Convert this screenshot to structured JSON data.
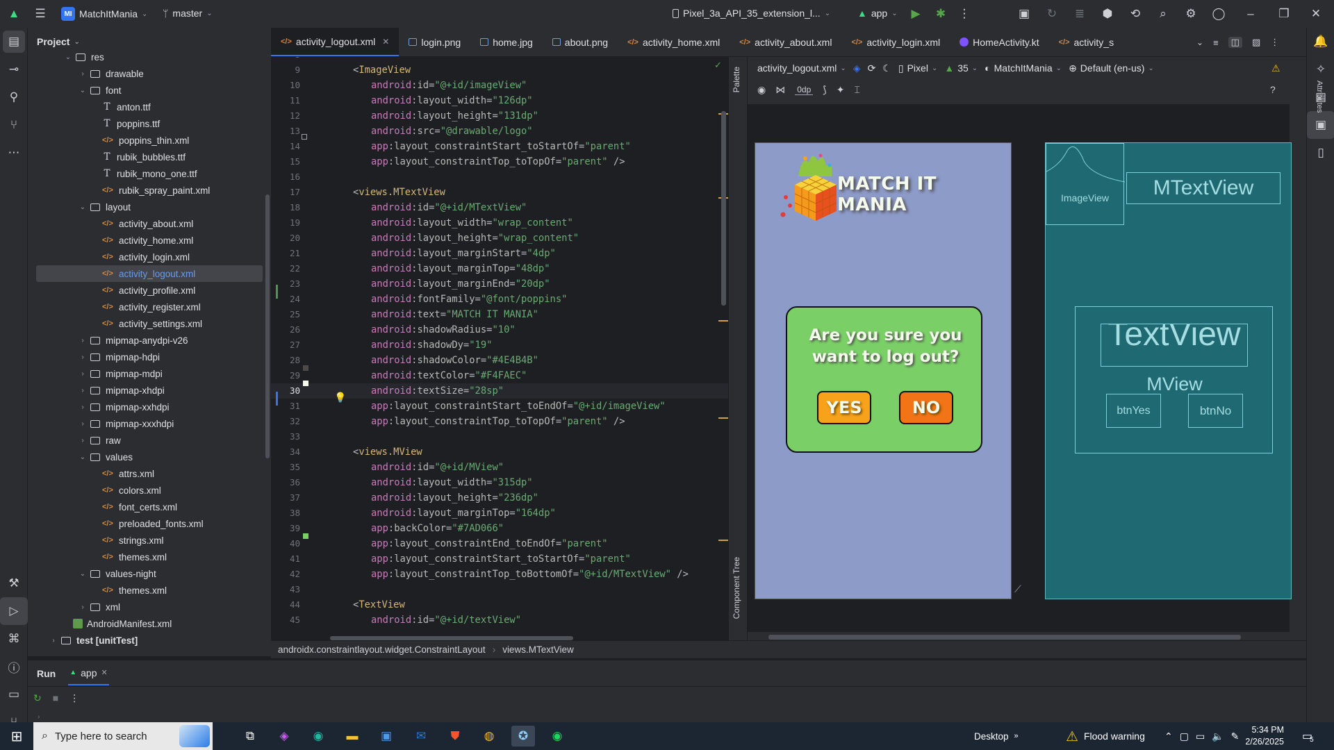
{
  "titlebar": {
    "project_badge": "MI",
    "project_name": "MatchItMania",
    "branch": "master",
    "device": "Pixel_3a_API_35_extension_l...",
    "run_config": "app"
  },
  "project_panel": {
    "title": "Project",
    "tree": [
      {
        "label": "res",
        "kind": "folder",
        "level": 3,
        "open": true
      },
      {
        "label": "drawable",
        "kind": "folder",
        "level": 4,
        "open": false
      },
      {
        "label": "font",
        "kind": "folder",
        "level": 4,
        "open": true
      },
      {
        "label": "anton.ttf",
        "kind": "font",
        "level": 5
      },
      {
        "label": "poppins.ttf",
        "kind": "font",
        "level": 5
      },
      {
        "label": "poppins_thin.xml",
        "kind": "xml",
        "level": 5
      },
      {
        "label": "rubik_bubbles.ttf",
        "kind": "font",
        "level": 5
      },
      {
        "label": "rubik_mono_one.ttf",
        "kind": "font",
        "level": 5
      },
      {
        "label": "rubik_spray_paint.xml",
        "kind": "xml",
        "level": 5
      },
      {
        "label": "layout",
        "kind": "folder",
        "level": 4,
        "open": true
      },
      {
        "label": "activity_about.xml",
        "kind": "xml",
        "level": 5
      },
      {
        "label": "activity_home.xml",
        "kind": "xml",
        "level": 5
      },
      {
        "label": "activity_login.xml",
        "kind": "xml",
        "level": 5
      },
      {
        "label": "activity_logout.xml",
        "kind": "xml",
        "level": 5,
        "selected": true
      },
      {
        "label": "activity_profile.xml",
        "kind": "xml",
        "level": 5
      },
      {
        "label": "activity_register.xml",
        "kind": "xml",
        "level": 5
      },
      {
        "label": "activity_settings.xml",
        "kind": "xml",
        "level": 5
      },
      {
        "label": "mipmap-anydpi-v26",
        "kind": "folder",
        "level": 4,
        "open": false
      },
      {
        "label": "mipmap-hdpi",
        "kind": "folder",
        "level": 4,
        "open": false
      },
      {
        "label": "mipmap-mdpi",
        "kind": "folder",
        "level": 4,
        "open": false
      },
      {
        "label": "mipmap-xhdpi",
        "kind": "folder",
        "level": 4,
        "open": false
      },
      {
        "label": "mipmap-xxhdpi",
        "kind": "folder",
        "level": 4,
        "open": false
      },
      {
        "label": "mipmap-xxxhdpi",
        "kind": "folder",
        "level": 4,
        "open": false
      },
      {
        "label": "raw",
        "kind": "folder",
        "level": 4,
        "open": false
      },
      {
        "label": "values",
        "kind": "folder",
        "level": 4,
        "open": true
      },
      {
        "label": "attrs.xml",
        "kind": "xml",
        "level": 5
      },
      {
        "label": "colors.xml",
        "kind": "xml",
        "level": 5
      },
      {
        "label": "font_certs.xml",
        "kind": "xml",
        "level": 5
      },
      {
        "label": "preloaded_fonts.xml",
        "kind": "xml",
        "level": 5
      },
      {
        "label": "strings.xml",
        "kind": "xml",
        "level": 5
      },
      {
        "label": "themes.xml",
        "kind": "xml",
        "level": 5
      },
      {
        "label": "values-night",
        "kind": "folder",
        "level": 4,
        "open": true
      },
      {
        "label": "themes.xml",
        "kind": "xml",
        "level": 5
      },
      {
        "label": "xml",
        "kind": "folder",
        "level": 4,
        "open": false
      },
      {
        "label": "AndroidManifest.xml",
        "kind": "manifest",
        "level": 3
      },
      {
        "label": "test [unitTest]",
        "kind": "folder",
        "level": 2,
        "open": false
      }
    ]
  },
  "tabs": [
    {
      "label": "activity_logout.xml",
      "kind": "xml",
      "active": true,
      "closable": true
    },
    {
      "label": "login.png",
      "kind": "png"
    },
    {
      "label": "home.jpg",
      "kind": "png"
    },
    {
      "label": "about.png",
      "kind": "png"
    },
    {
      "label": "activity_home.xml",
      "kind": "xml"
    },
    {
      "label": "activity_about.xml",
      "kind": "xml"
    },
    {
      "label": "activity_login.xml",
      "kind": "xml"
    },
    {
      "label": "HomeActivity.kt",
      "kind": "kt"
    },
    {
      "label": "activity_s",
      "kind": "xml"
    }
  ],
  "editor": {
    "current_line": 30,
    "lines": [
      {
        "n": "8",
        "parts": []
      },
      {
        "n": "9",
        "parts": [
          [
            "pun",
            "<"
          ],
          [
            "tag",
            "ImageView"
          ]
        ],
        "indent": 0
      },
      {
        "n": "10",
        "indent": 1,
        "parts": [
          [
            "ns",
            "android"
          ],
          [
            "pun",
            ":"
          ],
          [
            "attr",
            "id"
          ],
          [
            "pun",
            "="
          ],
          [
            "str",
            "\"@+id/imageView\""
          ]
        ]
      },
      {
        "n": "11",
        "indent": 1,
        "parts": [
          [
            "ns",
            "android"
          ],
          [
            "pun",
            ":"
          ],
          [
            "attr",
            "layout_width"
          ],
          [
            "pun",
            "="
          ],
          [
            "str",
            "\"126dp\""
          ]
        ]
      },
      {
        "n": "12",
        "indent": 1,
        "parts": [
          [
            "ns",
            "android"
          ],
          [
            "pun",
            ":"
          ],
          [
            "attr",
            "layout_height"
          ],
          [
            "pun",
            "="
          ],
          [
            "str",
            "\"131dp\""
          ]
        ]
      },
      {
        "n": "13",
        "indent": 1,
        "parts": [
          [
            "ns",
            "android"
          ],
          [
            "pun",
            ":"
          ],
          [
            "attr",
            "src"
          ],
          [
            "pun",
            "="
          ],
          [
            "str",
            "\"@drawable/logo\""
          ]
        ]
      },
      {
        "n": "14",
        "indent": 1,
        "parts": [
          [
            "ns",
            "app"
          ],
          [
            "pun",
            ":"
          ],
          [
            "attr",
            "layout_constraintStart_toStartOf"
          ],
          [
            "pun",
            "="
          ],
          [
            "str",
            "\"parent\""
          ]
        ]
      },
      {
        "n": "15",
        "indent": 1,
        "parts": [
          [
            "ns",
            "app"
          ],
          [
            "pun",
            ":"
          ],
          [
            "attr",
            "layout_constraintTop_toTopOf"
          ],
          [
            "pun",
            "="
          ],
          [
            "str",
            "\"parent\""
          ],
          [
            "pun",
            " />"
          ]
        ]
      },
      {
        "n": "16",
        "parts": []
      },
      {
        "n": "17",
        "indent": 0,
        "parts": [
          [
            "pun",
            "<"
          ],
          [
            "tag",
            "views.MTextView"
          ]
        ]
      },
      {
        "n": "18",
        "indent": 1,
        "parts": [
          [
            "ns",
            "android"
          ],
          [
            "pun",
            ":"
          ],
          [
            "attr",
            "id"
          ],
          [
            "pun",
            "="
          ],
          [
            "str",
            "\"@+id/MTextView\""
          ]
        ]
      },
      {
        "n": "19",
        "indent": 1,
        "parts": [
          [
            "ns",
            "android"
          ],
          [
            "pun",
            ":"
          ],
          [
            "attr",
            "layout_width"
          ],
          [
            "pun",
            "="
          ],
          [
            "str",
            "\"wrap_content\""
          ]
        ]
      },
      {
        "n": "20",
        "indent": 1,
        "parts": [
          [
            "ns",
            "android"
          ],
          [
            "pun",
            ":"
          ],
          [
            "attr",
            "layout_height"
          ],
          [
            "pun",
            "="
          ],
          [
            "str",
            "\"wrap_content\""
          ]
        ]
      },
      {
        "n": "21",
        "indent": 1,
        "parts": [
          [
            "ns",
            "android"
          ],
          [
            "pun",
            ":"
          ],
          [
            "attr",
            "layout_marginStart"
          ],
          [
            "pun",
            "="
          ],
          [
            "str",
            "\"4dp\""
          ]
        ]
      },
      {
        "n": "22",
        "indent": 1,
        "parts": [
          [
            "ns",
            "android"
          ],
          [
            "pun",
            ":"
          ],
          [
            "attr",
            "layout_marginTop"
          ],
          [
            "pun",
            "="
          ],
          [
            "str",
            "\"48dp\""
          ]
        ]
      },
      {
        "n": "23",
        "indent": 1,
        "parts": [
          [
            "ns",
            "android"
          ],
          [
            "pun",
            ":"
          ],
          [
            "attr",
            "layout_marginEnd"
          ],
          [
            "pun",
            "="
          ],
          [
            "str",
            "\"20dp\""
          ]
        ]
      },
      {
        "n": "24",
        "indent": 1,
        "parts": [
          [
            "ns",
            "android"
          ],
          [
            "pun",
            ":"
          ],
          [
            "attr",
            "fontFamily"
          ],
          [
            "pun",
            "="
          ],
          [
            "str",
            "\"@font/poppins\""
          ]
        ]
      },
      {
        "n": "25",
        "indent": 1,
        "parts": [
          [
            "ns",
            "android"
          ],
          [
            "pun",
            ":"
          ],
          [
            "attr",
            "text"
          ],
          [
            "pun",
            "="
          ],
          [
            "str",
            "\"MATCH IT MANIA\""
          ]
        ]
      },
      {
        "n": "26",
        "indent": 1,
        "parts": [
          [
            "ns",
            "android"
          ],
          [
            "pun",
            ":"
          ],
          [
            "attr",
            "shadowRadius"
          ],
          [
            "pun",
            "="
          ],
          [
            "str",
            "\"10\""
          ]
        ]
      },
      {
        "n": "27",
        "indent": 1,
        "parts": [
          [
            "ns",
            "android"
          ],
          [
            "pun",
            ":"
          ],
          [
            "attr",
            "shadowDy"
          ],
          [
            "pun",
            "="
          ],
          [
            "str",
            "\"19\""
          ]
        ]
      },
      {
        "n": "28",
        "indent": 1,
        "parts": [
          [
            "ns",
            "android"
          ],
          [
            "pun",
            ":"
          ],
          [
            "attr",
            "shadowColor"
          ],
          [
            "pun",
            "="
          ],
          [
            "str",
            "\"#4E4B4B\""
          ]
        ]
      },
      {
        "n": "29",
        "indent": 1,
        "parts": [
          [
            "ns",
            "android"
          ],
          [
            "pun",
            ":"
          ],
          [
            "attr",
            "textColor"
          ],
          [
            "pun",
            "="
          ],
          [
            "str",
            "\"#F4FAEC\""
          ]
        ]
      },
      {
        "n": "30",
        "indent": 1,
        "parts": [
          [
            "ns",
            "android"
          ],
          [
            "pun",
            ":"
          ],
          [
            "attr",
            "textSize"
          ],
          [
            "pun",
            "="
          ],
          [
            "str",
            "\"28sp\""
          ]
        ]
      },
      {
        "n": "31",
        "indent": 1,
        "parts": [
          [
            "ns",
            "app"
          ],
          [
            "pun",
            ":"
          ],
          [
            "attr",
            "layout_constraintStart_toEndOf"
          ],
          [
            "pun",
            "="
          ],
          [
            "str",
            "\"@+id/imageView\""
          ]
        ]
      },
      {
        "n": "32",
        "indent": 1,
        "parts": [
          [
            "ns",
            "app"
          ],
          [
            "pun",
            ":"
          ],
          [
            "attr",
            "layout_constraintTop_toTopOf"
          ],
          [
            "pun",
            "="
          ],
          [
            "str",
            "\"parent\""
          ],
          [
            "pun",
            " />"
          ]
        ]
      },
      {
        "n": "33",
        "parts": []
      },
      {
        "n": "34",
        "indent": 0,
        "parts": [
          [
            "pun",
            "<"
          ],
          [
            "tag",
            "views.MView"
          ]
        ]
      },
      {
        "n": "35",
        "indent": 1,
        "parts": [
          [
            "ns",
            "android"
          ],
          [
            "pun",
            ":"
          ],
          [
            "attr",
            "id"
          ],
          [
            "pun",
            "="
          ],
          [
            "str",
            "\"@+id/MView\""
          ]
        ]
      },
      {
        "n": "36",
        "indent": 1,
        "parts": [
          [
            "ns",
            "android"
          ],
          [
            "pun",
            ":"
          ],
          [
            "attr",
            "layout_width"
          ],
          [
            "pun",
            "="
          ],
          [
            "str",
            "\"315dp\""
          ]
        ]
      },
      {
        "n": "37",
        "indent": 1,
        "parts": [
          [
            "ns",
            "android"
          ],
          [
            "pun",
            ":"
          ],
          [
            "attr",
            "layout_height"
          ],
          [
            "pun",
            "="
          ],
          [
            "str",
            "\"236dp\""
          ]
        ]
      },
      {
        "n": "38",
        "indent": 1,
        "parts": [
          [
            "ns",
            "android"
          ],
          [
            "pun",
            ":"
          ],
          [
            "attr",
            "layout_marginTop"
          ],
          [
            "pun",
            "="
          ],
          [
            "str",
            "\"164dp\""
          ]
        ]
      },
      {
        "n": "39",
        "indent": 1,
        "parts": [
          [
            "ns",
            "app"
          ],
          [
            "pun",
            ":"
          ],
          [
            "attr",
            "backColor"
          ],
          [
            "pun",
            "="
          ],
          [
            "str",
            "\"#7AD066\""
          ]
        ]
      },
      {
        "n": "40",
        "indent": 1,
        "parts": [
          [
            "ns",
            "app"
          ],
          [
            "pun",
            ":"
          ],
          [
            "attr",
            "layout_constraintEnd_toEndOf"
          ],
          [
            "pun",
            "="
          ],
          [
            "str",
            "\"parent\""
          ]
        ]
      },
      {
        "n": "41",
        "indent": 1,
        "parts": [
          [
            "ns",
            "app"
          ],
          [
            "pun",
            ":"
          ],
          [
            "attr",
            "layout_constraintStart_toStartOf"
          ],
          [
            "pun",
            "="
          ],
          [
            "str",
            "\"parent\""
          ]
        ]
      },
      {
        "n": "42",
        "indent": 1,
        "parts": [
          [
            "ns",
            "app"
          ],
          [
            "pun",
            ":"
          ],
          [
            "attr",
            "layout_constraintTop_toBottomOf"
          ],
          [
            "pun",
            "="
          ],
          [
            "str",
            "\"@+id/MTextView\""
          ],
          [
            "pun",
            " />"
          ]
        ]
      },
      {
        "n": "43",
        "parts": []
      },
      {
        "n": "44",
        "indent": 0,
        "parts": [
          [
            "pun",
            "<"
          ],
          [
            "tag",
            "TextView"
          ]
        ]
      },
      {
        "n": "45",
        "indent": 1,
        "parts": [
          [
            "ns",
            "android"
          ],
          [
            "pun",
            ":"
          ],
          [
            "attr",
            "id"
          ],
          [
            "pun",
            "="
          ],
          [
            "str",
            "\"@+id/textView\""
          ]
        ]
      }
    ]
  },
  "design": {
    "palette_label": "Palette",
    "component_tree_label": "Component Tree",
    "attributes_label": "Attributes",
    "file": "activity_logout.xml",
    "device": "Pixel",
    "api": "35",
    "theme": "MatchItMania",
    "locale": "Default (en-us)",
    "margin": "0dp",
    "preview": {
      "app_title": "MATCH IT MANIA",
      "prompt": "Are you sure you want to log out?",
      "yes": "YES",
      "no": "NO",
      "background": "#8D9BC9",
      "mview_color": "#7AD066"
    },
    "blueprint": {
      "imageview": "ImageView",
      "mtextview": "MTextView",
      "textview": "TextView",
      "mview": "MView",
      "btnyes": "btnYes",
      "btnno": "btnNo"
    }
  },
  "breadcrumb": [
    "androidx.constraintlayout.widget.ConstraintLayout",
    "views.MTextView"
  ],
  "run_panel": {
    "title": "Run",
    "tab": "app"
  },
  "taskbar": {
    "search_placeholder": "Type here to search",
    "desktop_label": "Desktop",
    "weather": "Flood warning",
    "time": "5:34 PM",
    "date": "2/26/2025",
    "notifications": "5"
  }
}
